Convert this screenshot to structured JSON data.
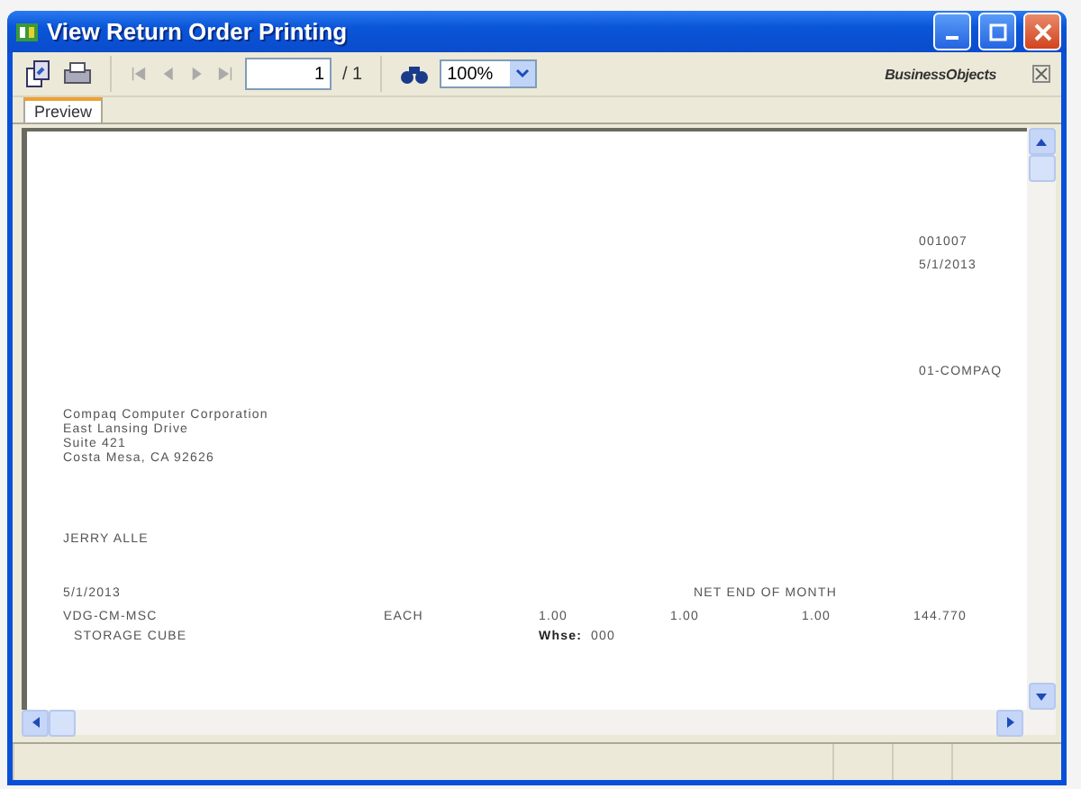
{
  "window": {
    "title": "View Return Order Printing"
  },
  "toolbar": {
    "page_number": "1",
    "page_total": "/ 1",
    "zoom": "100%",
    "logo": "BusinessObjects"
  },
  "tabs": [
    {
      "label": "Preview",
      "selected": true
    }
  ],
  "report": {
    "document_number": "001007",
    "document_date": "5/1/2013",
    "customer_code": "01-COMPAQ",
    "address": [
      "Compaq Computer Corporation",
      "East Lansing Drive",
      "Suite 421",
      "Costa Mesa, CA 92626"
    ],
    "contact": "JERRY ALLE",
    "order_date": "5/1/2013",
    "terms": "NET END OF MONTH",
    "line_item": {
      "item": "VDG-CM-MSC",
      "unit": "EACH",
      "column_3": "1.00",
      "column_4": "1.00",
      "column_5": "1.00",
      "amount": "144.770",
      "description": "STORAGE CUBE",
      "warehouse_label": "Whse:",
      "warehouse": "000"
    }
  }
}
